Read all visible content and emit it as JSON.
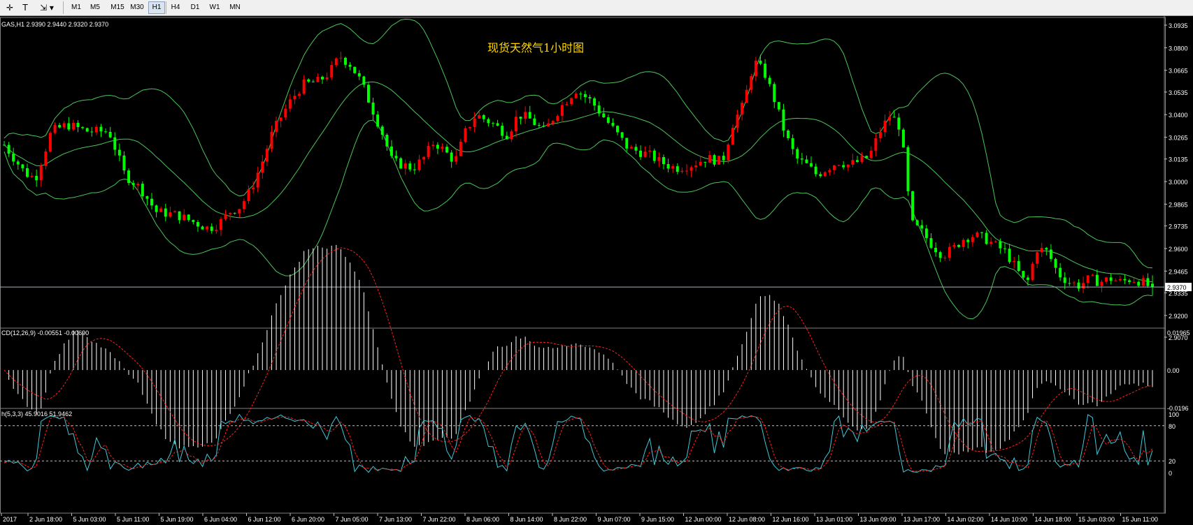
{
  "toolbar": {
    "icon_tools": [
      "crosshair-icon",
      "text-icon",
      "objects-icon"
    ],
    "timeframes": [
      "M1",
      "M5",
      "M15",
      "M30",
      "H1",
      "H4",
      "D1",
      "W1",
      "MN"
    ],
    "active_timeframe": "H1"
  },
  "main_panel": {
    "header": "GAS,H1  2.9390 2.9440 2.9320 2.9370",
    "title": "现货天然气1小时图",
    "current_price": "2.9370",
    "y_ticks": [
      "3.0935",
      "3.0800",
      "3.0665",
      "3.0535",
      "3.0400",
      "3.0265",
      "3.0135",
      "3.0000",
      "2.9865",
      "2.9735",
      "2.9600",
      "2.9465",
      "2.9335",
      "2.9200",
      "2.9070"
    ]
  },
  "macd_panel": {
    "header": "CD(12,26,9) -0.00551 -0.00690",
    "y_ticks": [
      "0.01965",
      "0.00",
      "-0.0196"
    ]
  },
  "stoch_panel": {
    "header": "h(5,3,3) 45.9016 51.9462",
    "y_ticks": [
      "100",
      "80",
      "20",
      "0"
    ]
  },
  "x_ticks": [
    "2017",
    "2 Jun 18:00",
    "5 Jun 03:00",
    "5 Jun 11:00",
    "5 Jun 19:00",
    "6 Jun 04:00",
    "6 Jun 12:00",
    "6 Jun 20:00",
    "7 Jun 05:00",
    "7 Jun 13:00",
    "7 Jun 22:00",
    "8 Jun 06:00",
    "8 Jun 14:00",
    "8 Jun 22:00",
    "9 Jun 07:00",
    "9 Jun 15:00",
    "12 Jun 00:00",
    "12 Jun 08:00",
    "12 Jun 16:00",
    "13 Jun 01:00",
    "13 Jun 09:00",
    "13 Jun 17:00",
    "14 Jun 02:00",
    "14 Jun 10:00",
    "14 Jun 18:00",
    "15 Jun 03:00",
    "15 Jun 11:00"
  ],
  "colors": {
    "up": "#ff0000",
    "down": "#00ff00",
    "band": "#4cc45a",
    "macd_hist": "#ffffff",
    "macd_signal": "#ff2020",
    "stoch_main": "#40c8d8",
    "stoch_signal": "#ff2020",
    "title": "#ffd700"
  },
  "chart_data": {
    "type": "candlestick",
    "symbol": "GAS",
    "timeframe": "H1",
    "candle_count": 250,
    "ohlc_keypoints": [
      [
        0,
        3.022
      ],
      [
        8,
        3.005
      ],
      [
        12,
        3.002
      ],
      [
        18,
        3.03
      ],
      [
        24,
        3.034
      ],
      [
        32,
        3.03
      ],
      [
        40,
        3.03
      ],
      [
        46,
        3.004
      ],
      [
        52,
        2.996
      ],
      [
        58,
        2.982
      ],
      [
        66,
        2.98
      ],
      [
        72,
        2.976
      ],
      [
        78,
        2.972
      ],
      [
        82,
        2.975
      ],
      [
        86,
        2.982
      ],
      [
        90,
        2.985
      ],
      [
        94,
        2.995
      ],
      [
        98,
        3.01
      ],
      [
        102,
        3.028
      ],
      [
        106,
        3.04
      ],
      [
        110,
        3.05
      ],
      [
        114,
        3.058
      ],
      [
        120,
        3.06
      ],
      [
        124,
        3.065
      ],
      [
        128,
        3.075
      ],
      [
        132,
        3.07
      ],
      [
        136,
        3.06
      ],
      [
        140,
        3.045
      ],
      [
        144,
        3.03
      ],
      [
        148,
        3.012
      ],
      [
        152,
        3.01
      ],
      [
        156,
        3.008
      ],
      [
        160,
        3.014
      ],
      [
        164,
        3.024
      ],
      [
        168,
        3.018
      ],
      [
        172,
        3.012
      ],
      [
        176,
        3.03
      ],
      [
        180,
        3.04
      ],
      [
        186,
        3.035
      ],
      [
        192,
        3.028
      ],
      [
        196,
        3.04
      ],
      [
        200,
        3.038
      ],
      [
        206,
        3.03
      ],
      [
        212,
        3.044
      ],
      [
        218,
        3.055
      ],
      [
        224,
        3.048
      ],
      [
        232,
        3.032
      ],
      [
        238,
        3.02
      ],
      [
        242,
        3.018
      ],
      [
        246,
        3.016
      ],
      [
        250,
        3.012
      ],
      [
        256,
        3.008
      ],
      [
        262,
        3.01
      ],
      [
        268,
        3.014
      ],
      [
        274,
        3.012
      ],
      [
        278,
        3.035
      ],
      [
        282,
        3.046
      ],
      [
        286,
        3.072
      ],
      [
        290,
        3.065
      ],
      [
        294,
        3.048
      ],
      [
        298,
        3.028
      ],
      [
        302,
        3.014
      ],
      [
        306,
        3.01
      ],
      [
        310,
        3.004
      ],
      [
        314,
        3.008
      ],
      [
        318,
        3.012
      ],
      [
        322,
        3.01
      ],
      [
        326,
        3.012
      ],
      [
        330,
        3.015
      ],
      [
        334,
        3.03
      ],
      [
        338,
        3.04
      ],
      [
        342,
        3.032
      ],
      [
        346,
        2.975
      ],
      [
        350,
        2.97
      ],
      [
        354,
        2.962
      ],
      [
        358,
        2.956
      ],
      [
        362,
        2.96
      ],
      [
        366,
        2.966
      ],
      [
        370,
        2.968
      ],
      [
        374,
        2.966
      ],
      [
        378,
        2.962
      ],
      [
        382,
        2.958
      ],
      [
        386,
        2.948
      ],
      [
        390,
        2.938
      ],
      [
        394,
        2.96
      ],
      [
        398,
        2.958
      ],
      [
        402,
        2.945
      ],
      [
        406,
        2.94
      ],
      [
        410,
        2.938
      ],
      [
        414,
        2.942
      ],
      [
        418,
        2.94
      ],
      [
        422,
        2.942
      ],
      [
        426,
        2.94
      ],
      [
        430,
        2.942
      ],
      [
        434,
        2.94
      ],
      [
        438,
        2.936
      ]
    ],
    "last": {
      "open": 2.939,
      "high": 2.944,
      "low": 2.932,
      "close": 2.937
    },
    "y_range": [
      2.907,
      3.0935
    ],
    "indicators": [
      "Bollinger Bands",
      "MACD(12,26,9)",
      "Stochastic(5,3,3)"
    ],
    "macd": {
      "main": -0.00551,
      "signal": -0.0069,
      "range": [
        -0.0196,
        0.01965
      ]
    },
    "stochastic": {
      "main": 45.9016,
      "signal": 51.9462,
      "levels": [
        20,
        80
      ],
      "range": [
        0,
        100
      ]
    }
  }
}
